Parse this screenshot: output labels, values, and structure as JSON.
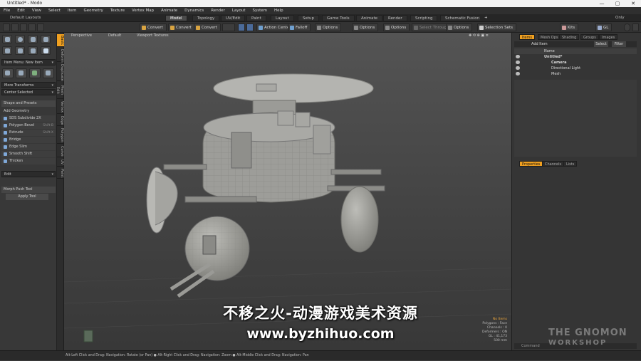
{
  "window": {
    "title": "Untitled* - Modo",
    "minimize": "—",
    "maximize": "▢",
    "close": "✕"
  },
  "menu": [
    "File",
    "Edit",
    "View",
    "Select",
    "Item",
    "Geometry",
    "Texture",
    "Vertex Map",
    "Animate",
    "Dynamics",
    "Render",
    "Layout",
    "System",
    "Help"
  ],
  "layout_bar": {
    "layouts_label": "Default Layouts",
    "tabs": [
      "Model",
      "Topology",
      "UV/Edit",
      "Paint",
      "Layout",
      "Setup",
      "Game Tools",
      "Animate",
      "Render",
      "Scripting",
      "Schematic Fusion"
    ],
    "active_tab": "Model",
    "add": "+",
    "right": "Only"
  },
  "toolbar": {
    "convert1": "Convert",
    "convert2": "Convert",
    "convert3": "Convert",
    "action_center": "Action Center",
    "falloff": "Falloff",
    "options1": "Options",
    "options2": "Options",
    "options3": "Options",
    "options4": "Options",
    "snap": "Select Through",
    "selection_sets": "Selection Sets",
    "kits": "Kits",
    "gl": "GL"
  },
  "left_panel": {
    "item_drop": "Item Menu: New Item",
    "move_transforms": "More Transforms",
    "center_selected": "Center Selected",
    "shape_header": "Shape and Presets",
    "add_geometry": "Add Geometry",
    "tools": [
      {
        "label": "SDS Subdivide 2X",
        "key": ""
      },
      {
        "label": "Polygon Bevel",
        "key": "Shift-B"
      },
      {
        "label": "Extrude",
        "key": "Shift-X"
      },
      {
        "label": "Bridge",
        "key": ""
      },
      {
        "label": "Edge Slim",
        "key": ""
      },
      {
        "label": "Smooth Shift",
        "key": ""
      },
      {
        "label": "Thicken",
        "key": ""
      }
    ],
    "edit_drop": "Edit",
    "tool_props": "Morph Push Tool",
    "apply": "Apply Tool",
    "side_tabs": [
      "Basic",
      "Deform",
      "Duplicate",
      "Mesh Edit",
      "Vertex",
      "Edge",
      "Polygon",
      "Curve",
      "UV",
      "Paint"
    ]
  },
  "viewport": {
    "view": "Perspective",
    "style": "Default",
    "shading": "Viewport Textures",
    "hud": [
      "No Items",
      "Polygons : Face",
      "Channels : 0",
      "Deformers : ON",
      "GL : 41,173",
      "500 mm"
    ]
  },
  "right_panel": {
    "tabs": [
      "Items",
      "Mesh Ops",
      "Shading",
      "Groups",
      "Images"
    ],
    "add_item": "Add Item",
    "select": "Select",
    "filter": "Filter",
    "col_name": "Name",
    "items": [
      "Untitled*",
      "Camera",
      "Directional Light",
      "Mesh"
    ],
    "prop_tabs": [
      "Properties",
      "Channels",
      "Lists"
    ],
    "command": "Command"
  },
  "status": "Alt-Left Click and Drag: Navigation: Rotate (or Pan)  ● Alt-Right Click and Drag: Navigation: Zoom  ● Alt-Middle Click and Drag: Navigation: Pan",
  "overlay": {
    "subtitle": "不移之火-动漫游戏美术资源",
    "website": "www.byzhihuo.com"
  },
  "watermark": {
    "line1": "THE GNOMON",
    "line2": "WORKSHOP"
  },
  "colors": {
    "accent": "#f0a020",
    "model": "#9a9a96"
  }
}
